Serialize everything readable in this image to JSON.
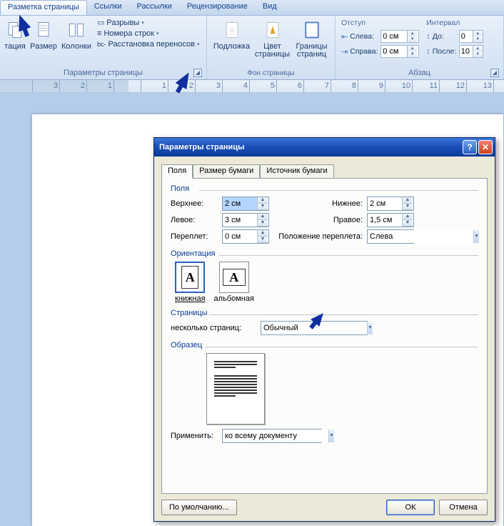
{
  "ribbon": {
    "tabs": [
      "Разметка страницы",
      "Ссылки",
      "Рассылки",
      "Рецензирование",
      "Вид"
    ],
    "active_tab": 0,
    "group_page_setup": {
      "label": "Параметры страницы",
      "orientation": "тация",
      "size": "Размер",
      "columns": "Колонки",
      "breaks": "Разрывы",
      "line_numbers": "Номера строк",
      "hyphenation": "Расстановка переносов"
    },
    "group_page_bg": {
      "label": "Фон страницы",
      "watermark": "Подложка",
      "page_color": "Цвет страницы",
      "page_borders": "Границы страниц"
    },
    "group_paragraph": {
      "label": "Абзац",
      "indent_header": "Отступ",
      "left_label": "Слева:",
      "right_label": "Справа:",
      "left_value": "0 см",
      "right_value": "0 см",
      "spacing_header": "Интервал",
      "before_label": "До:",
      "after_label": "После:",
      "before_value": "0",
      "after_value": "10"
    }
  },
  "ruler_start": 3,
  "dialog": {
    "title": "Параметры страницы",
    "tabs": [
      "Поля",
      "Размер бумаги",
      "Источник бумаги"
    ],
    "active_tab": 0,
    "margins": {
      "legend": "Поля",
      "top_label": "Верхнее:",
      "top_value": "2 см",
      "bottom_label": "Нижнее:",
      "bottom_value": "2 см",
      "left_label": "Левое:",
      "left_value": "3 см",
      "right_label": "Правое:",
      "right_value": "1,5 см",
      "gutter_label": "Переплет:",
      "gutter_value": "0 см",
      "gutter_pos_label": "Положение переплета:",
      "gutter_pos_value": "Слева"
    },
    "orientation": {
      "legend": "Ориентация",
      "portrait": "книжная",
      "landscape": "альбомная"
    },
    "pages": {
      "legend": "Страницы",
      "multi_label": "несколько страниц:",
      "multi_value": "Обычный"
    },
    "preview": {
      "legend": "Образец",
      "apply_label": "Применить:",
      "apply_value": "ко всему документу"
    },
    "buttons": {
      "default": "По умолчанию...",
      "ok": "ОК",
      "cancel": "Отмена"
    }
  }
}
